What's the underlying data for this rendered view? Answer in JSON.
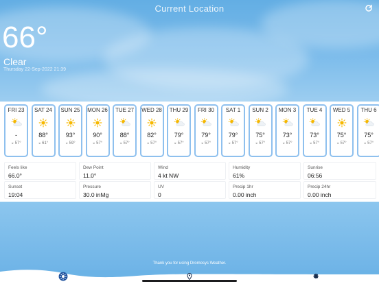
{
  "header": {
    "location_title": "Current Location",
    "refresh_icon": "refresh-icon"
  },
  "current": {
    "temperature": "66°",
    "condition": "Clear",
    "datetime": "Thursday 22-Sep-2022 21:39"
  },
  "forecast": [
    {
      "day": "FRI 23",
      "icon": "partly-cloudy-icon",
      "high": "-",
      "low": "57°"
    },
    {
      "day": "SAT 24",
      "icon": "sun-icon",
      "high": "88°",
      "low": "61°"
    },
    {
      "day": "SUN 25",
      "icon": "sun-icon",
      "high": "93°",
      "low": "59°"
    },
    {
      "day": "MON 26",
      "icon": "sun-icon",
      "high": "90°",
      "low": "57°"
    },
    {
      "day": "TUE 27",
      "icon": "partly-cloudy-icon",
      "high": "88°",
      "low": "57°"
    },
    {
      "day": "WED 28",
      "icon": "sun-icon",
      "high": "82°",
      "low": "57°"
    },
    {
      "day": "THU 29",
      "icon": "partly-cloudy-icon",
      "high": "79°",
      "low": "57°"
    },
    {
      "day": "FRI 30",
      "icon": "partly-cloudy-icon",
      "high": "79°",
      "low": "57°"
    },
    {
      "day": "SAT 1",
      "icon": "partly-cloudy-icon",
      "high": "79°",
      "low": "57°"
    },
    {
      "day": "SUN 2",
      "icon": "partly-cloudy-icon",
      "high": "75°",
      "low": "57°"
    },
    {
      "day": "MON 3",
      "icon": "partly-cloudy-icon",
      "high": "73°",
      "low": "57°"
    },
    {
      "day": "TUE 4",
      "icon": "partly-cloudy-icon",
      "high": "73°",
      "low": "57°"
    },
    {
      "day": "WED 5",
      "icon": "sun-icon",
      "high": "75°",
      "low": "57°"
    },
    {
      "day": "THU 6",
      "icon": "partly-cloudy-icon",
      "high": "75°",
      "low": "57°"
    }
  ],
  "details": [
    {
      "label": "Feels like",
      "value": "66.0°"
    },
    {
      "label": "Dew Point",
      "value": "11.0°"
    },
    {
      "label": "Wind",
      "value": "4 kt NW"
    },
    {
      "label": "Humidity",
      "value": "61%"
    },
    {
      "label": "Sunrise",
      "value": "06:56"
    },
    {
      "label": "Sunset",
      "value": "19:04"
    },
    {
      "label": "Pressure",
      "value": "30.0 inMg"
    },
    {
      "label": "UV",
      "value": "0"
    },
    {
      "label": "Precip 1hr",
      "value": "0.00 inch"
    },
    {
      "label": "Precip 24hr",
      "value": "0.00 inch"
    }
  ],
  "footer": {
    "thanks": "Thank you for using Dromosys Weather."
  },
  "tabs": [
    {
      "name": "weather-tab",
      "icon": "sun-icon"
    },
    {
      "name": "map-tab",
      "icon": "location-pin-icon"
    },
    {
      "name": "settings-tab",
      "icon": "gear-icon"
    }
  ],
  "colors": {
    "sky": "#63aee4",
    "card_border": "#8ec0ee",
    "sun": "#f6b800",
    "tab_selected": "#1b4f9c"
  }
}
